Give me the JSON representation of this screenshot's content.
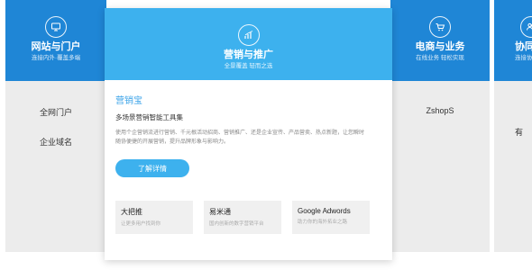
{
  "columns": {
    "portal": {
      "title": "网站与门户",
      "subtitle": "连接内外·覆盖多端",
      "items": [
        "全网门户",
        "企业域名"
      ],
      "icon": "monitor-icon"
    },
    "marketing": {
      "title": "营销与推广",
      "subtitle": "全景覆盖 轻而之选",
      "icon": "chart-icon",
      "product_name": "营销宝",
      "product_tagline": "多场景营销智能工具集",
      "description": "使用个企营销流进行营销、千元根活动招商、营销推广、还是企业宣传、产品营卖、热点新题，让您瞬时随协便捷的开展营销，提升品牌形象与影响力。",
      "cta_label": "了解详情",
      "products": [
        {
          "name": "大把推",
          "sub": "让更多用户找到你"
        },
        {
          "name": "易米通",
          "sub": "国内创新的数字营销平台"
        },
        {
          "name": "Google Adwords",
          "sub": "助力你的海外拓业之路"
        }
      ]
    },
    "commerce": {
      "title": "电商与业务",
      "subtitle": "在线业务 轻松实现",
      "items": [
        "ZshopS"
      ],
      "icon": "cart-icon"
    },
    "collab": {
      "title": "协同",
      "subtitle": "连接协同",
      "items": [
        "有"
      ],
      "icon": "people-icon"
    }
  },
  "colors": {
    "head_blue": "#1f86d6",
    "active_blue": "#3db1ee",
    "accent": "#3aa3e8"
  }
}
